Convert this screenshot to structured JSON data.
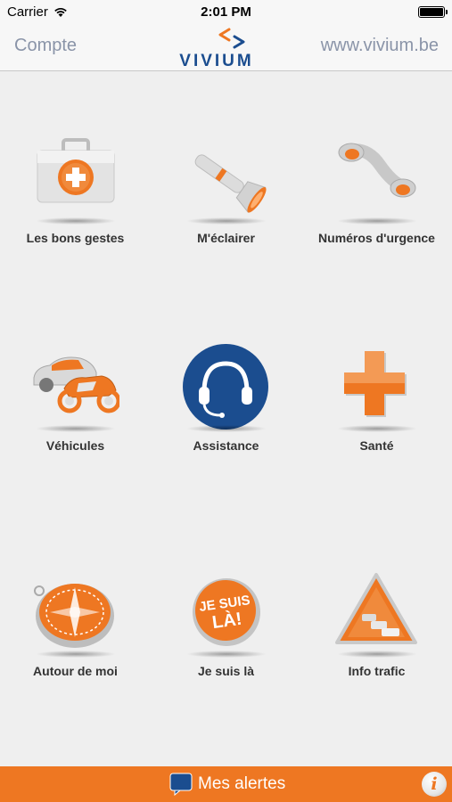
{
  "status_bar": {
    "carrier": "Carrier",
    "time": "2:01 PM"
  },
  "nav": {
    "left_label": "Compte",
    "right_label": "www.vivium.be",
    "logo_text": "VIVIUM"
  },
  "tiles": [
    {
      "label": "Les bons gestes",
      "icon": "first-aid-kit-icon"
    },
    {
      "label": "M'éclairer",
      "icon": "flashlight-icon"
    },
    {
      "label": "Numéros d'urgence",
      "icon": "phone-handset-icon"
    },
    {
      "label": "Véhicules",
      "icon": "car-motorbike-icon"
    },
    {
      "label": "Assistance",
      "icon": "headset-icon"
    },
    {
      "label": "Santé",
      "icon": "health-cross-icon"
    },
    {
      "label": "Autour de moi",
      "icon": "compass-icon"
    },
    {
      "label": "Je suis là",
      "icon": "je-suis-la-badge-icon",
      "badge_text": "JE SUIS LÀ!"
    },
    {
      "label": "Info trafic",
      "icon": "traffic-warning-icon"
    }
  ],
  "footer": {
    "alerts_label": "Mes alertes",
    "info_label": "i"
  },
  "colors": {
    "accent": "#ee7722",
    "brand_blue": "#1b4d8f",
    "nav_text": "#8a94a8"
  }
}
